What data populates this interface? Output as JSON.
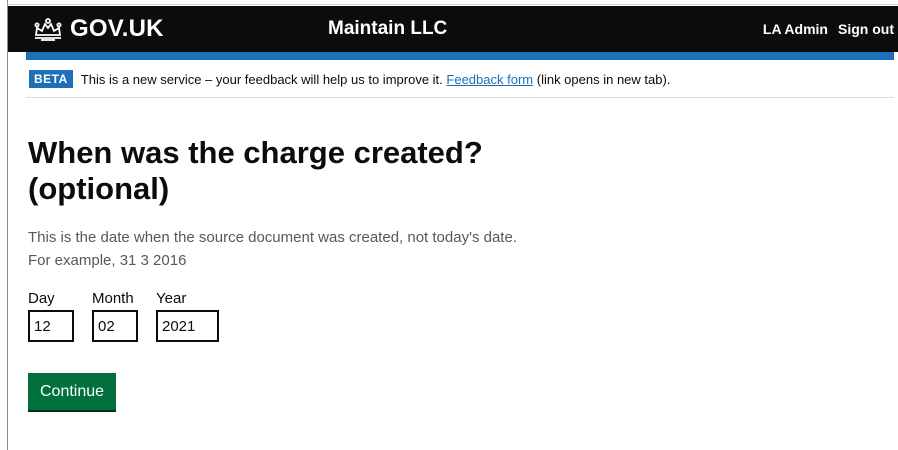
{
  "header": {
    "brand": "GOV.UK",
    "service_name": "Maintain LLC",
    "user_label": "LA Admin",
    "sign_out": "Sign out",
    "bar_color": "#0b0c0c",
    "accent_color": "#1d70b8"
  },
  "phase_banner": {
    "tag": "BETA",
    "text_before": "This is a new service – your feedback will help us to improve it.",
    "link_text": "Feedback form",
    "text_after": "(link opens in new tab)."
  },
  "page": {
    "title": "When was the charge created? (optional)",
    "hint_line1": "This is the date when the source document was created, not today's date.",
    "hint_line2": "For example, 31 3 2016"
  },
  "date_input": {
    "day_label": "Day",
    "day_value": "12",
    "month_label": "Month",
    "month_value": "02",
    "year_label": "Year",
    "year_value": "2021"
  },
  "actions": {
    "continue_label": "Continue",
    "button_color": "#00703c"
  },
  "icons": {
    "logo": "crown-icon"
  }
}
